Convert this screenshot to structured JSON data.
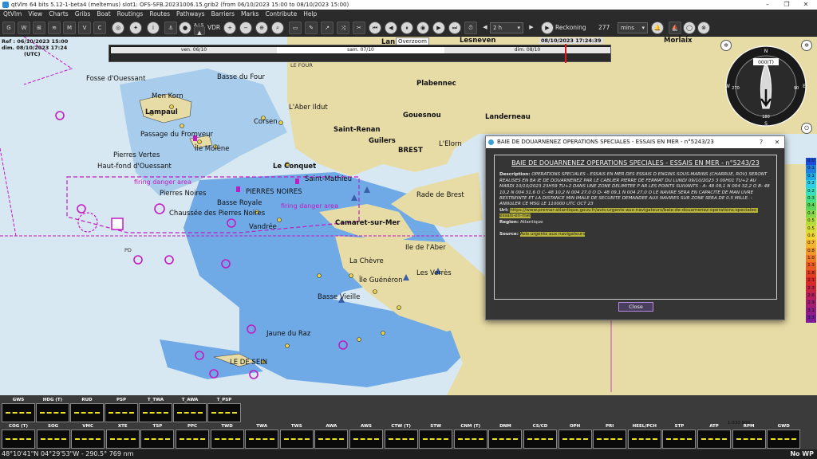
{
  "window": {
    "title": "qtVlm 64 bits 5.12-1-beta4 (meltemus) slot1: OFS-SFB.20231006.15.grib2 (from 06/10/2023 15:00 to 08/10/2023 15:00)",
    "minimize": "–",
    "maximize": "❐",
    "close": "✕"
  },
  "menu": [
    "QtVlm",
    "View",
    "Charts",
    "Gribs",
    "Boat",
    "Routings",
    "Routes",
    "Pathways",
    "Barriers",
    "Marks",
    "Contribute",
    "Help"
  ],
  "toolbar": {
    "vdr_label": "VDR",
    "ais_label": "A.I.S",
    "step_value": "2 h",
    "reckoning_label": "Reckoning",
    "reckoning_value": "277",
    "reckoning_unit": "mins"
  },
  "timebar": {
    "ref_line1": "Ref : 06/10/2023 15:00",
    "ref_line2": "dim. 08/10/2023 17:24",
    "ref_line3": "(UTC)",
    "current_date": "08/10/2023 17:24:39",
    "overzoom": "Overzoom",
    "days": [
      "ven. 06/10",
      "sam. 07/10",
      "dim. 08/10"
    ],
    "progress": 0.91
  },
  "map_labels": [
    "Fosse d'Ouessant",
    "Men Korn",
    "Lampaul",
    "Passage du Fromveur",
    "Île Molène",
    "Pierres Vertes",
    "Haut-fond d'Ouessant",
    "firing danger area",
    "Pierres Noires",
    "PIERRES NOIRES",
    "Basse Royale",
    "Chaussée des Pierres Noires",
    "Vandrée",
    "Basse du Four",
    "LE FOUR",
    "L'Aber Ildut",
    "Corsen",
    "Plabennec",
    "Gouesnou",
    "Landerneau",
    "Saint-Renan",
    "Guilers",
    "BREST",
    "L'Elorn",
    "Le Conquet",
    "Saint-Mathieu",
    "Rade de Brest",
    "Camaret-sur-Mer",
    "La Chèvre",
    "Ile de l'Aber",
    "Les Verrès",
    "Île Guénéron",
    "Basse Vieille",
    "Jaune du Raz",
    "LE DE SEIN",
    "Lesneven",
    "Morlaix",
    "Lan",
    "PD"
  ],
  "compass": {
    "heading": "000(T)",
    "n": "N",
    "e": "E",
    "w": "W",
    "s": "S",
    "d0": "0",
    "d90": "90",
    "d180": "180",
    "d270": "270"
  },
  "legend": [
    "0.0",
    "0.1",
    "0.1",
    "0.2",
    "0.2",
    "0.3",
    "0.4",
    "0.4",
    "0.5",
    "0.5",
    "0.6",
    "0.7",
    "0.8",
    "1.0",
    "1.3",
    "1.8",
    "2.1",
    "2.3",
    "2.6",
    "2.9",
    "3.1",
    "3.3"
  ],
  "legend_colors": [
    "#1b4bd8",
    "#1e7fe0",
    "#21a9e6",
    "#2ed1e6",
    "#35e0c0",
    "#46e08a",
    "#5bd65a",
    "#86d848",
    "#b5dc3a",
    "#d8dc35",
    "#f0d230",
    "#f3b52c",
    "#f39629",
    "#f07726",
    "#ea5a24",
    "#e23d22",
    "#d82a2a",
    "#c92440",
    "#b61f5b",
    "#a31c72",
    "#8f1a88",
    "#7a1a98"
  ],
  "dialog": {
    "title": "BAIE DE DOUARNENEZ OPERATIONS SPECIALES - ESSAIS EN MER - n°5243/23",
    "heading": "BAIE DE DOUARNENEZ OPERATIONS SPECIALES - ESSAIS EN MER - n°5243/23",
    "description_label": "Description:",
    "description": "OPERATIONS SPECIALES - ESSAIS EN MER DES ESSAIS D ENGINS SOUS-MARINS (CHARRUE, ROV) SERONT REALISES EN BA IE DE DOUARNENEZ PAR LE CABLIER PIERRE DE FERMAT DU LUNDI 09/10/2023 3 00H01 TU+2 AU MARDI 10/10/2023 23H59 TU+2 DANS UNE ZONE DELIMITEE P AR LES POINTS SUIVANTS : A- 48 09,1 N 004 32,2 O B- 48 10,2 N 004 31,6 O C- 48 10,2 N 004 27,0 O D- 48 09,1 N 004 27,0 O LE NAVIRE SERA EN CAPACITE DE MAN UVRE RESTREINTE ET LA DISTANCE MIN IMALE DE SECURITE DEMANDEE AUX NAVIRES SUR ZONE SERA DE 0.5 MILLE. - ANNULER CE MSG LE 110000 UTC OCT 23",
    "url_label": "Url:",
    "url": "https://www.premar-atlantique.gouv.fr/avis-urgents-aux-navigateurs/baie-de-douarnenez-operations-speciales-essais-en-mer",
    "region_label": "Region:",
    "region": "Atlantique",
    "source_label": "Source:",
    "source": "Avis urgents aux navigateurs",
    "close_button": "Close"
  },
  "instruments_top": [
    "GWS",
    "HDG (T)",
    "RUD",
    "PSP",
    "T_TWA",
    "T_AWA",
    "T_PSP"
  ],
  "instruments_bottom": [
    "COG (T)",
    "SOG",
    "VMC",
    "XTE",
    "TSP",
    "PPC",
    "TWD",
    "TWA",
    "TWS",
    "AWA",
    "AWS",
    "CTW (T)",
    "STW",
    "CNM (T)",
    "DNM",
    "CS/CD",
    "OPH",
    "PRI",
    "HEEL/PCH",
    "STP",
    "ATP",
    "RPM",
    "GWD"
  ],
  "scale": "1:330 800",
  "status": {
    "position": "48°10'41\"N 04°29'53\"W - 290.5° 769 nm",
    "waypoint": "No WP"
  },
  "colors": {
    "land": "#e8dca6",
    "shallow": "#6fa9e6",
    "deep": "#d8e8f2",
    "danger": "#c21bc2",
    "accent": "#e8e020"
  }
}
